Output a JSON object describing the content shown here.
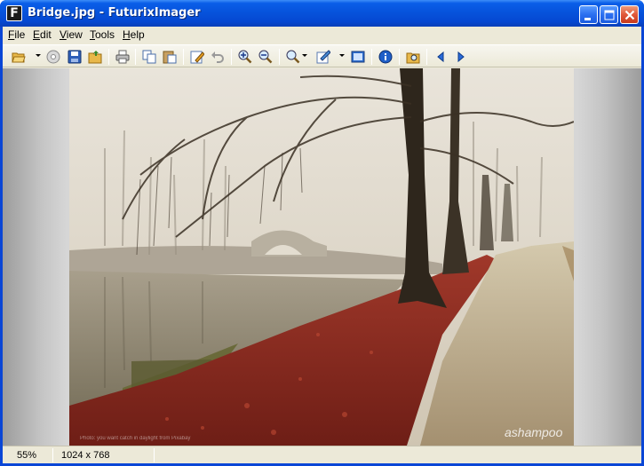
{
  "window": {
    "title": "Bridge.jpg - FuturixImager",
    "app_icon_letter": "F"
  },
  "menu": {
    "items": [
      {
        "label": "File",
        "accel": "F",
        "rest": "ile"
      },
      {
        "label": "Edit",
        "accel": "E",
        "rest": "dit"
      },
      {
        "label": "View",
        "accel": "V",
        "rest": "iew"
      },
      {
        "label": "Tools",
        "accel": "T",
        "rest": "ools"
      },
      {
        "label": "Help",
        "accel": "H",
        "rest": "elp"
      }
    ]
  },
  "toolbar": {
    "tools": [
      "open-folder-icon",
      "scan-icon",
      "save-icon",
      "browse-folder-icon",
      "print-icon",
      "copy-icon",
      "paste-icon",
      "edit-icon",
      "undo-icon",
      "zoom-in-icon",
      "zoom-out-icon",
      "zoom-icon",
      "adjust-icon",
      "fullscreen-icon",
      "info-icon",
      "find-icon",
      "previous-icon",
      "next-icon"
    ]
  },
  "image": {
    "watermark": "ashampoo",
    "caption": "Photo: you want catch in daylight from Pixabay"
  },
  "status": {
    "zoom": "55%",
    "dimensions": "1024 x 768"
  },
  "colors": {
    "titlebar": "#0653dc",
    "frame": "#ece9d8",
    "leaves": "#8e2a1f"
  }
}
